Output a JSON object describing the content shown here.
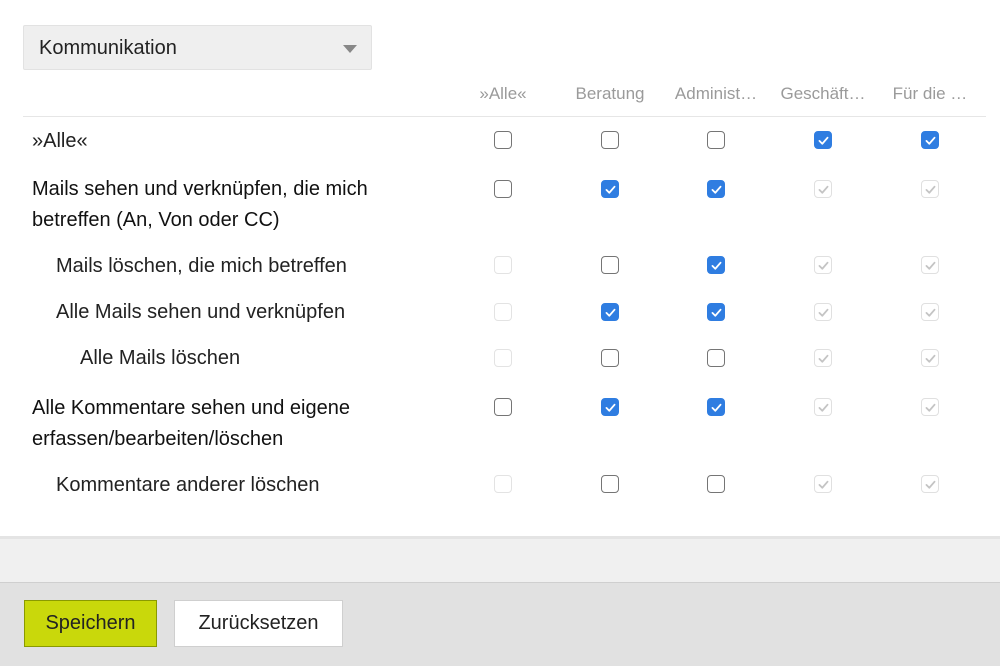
{
  "dropdown": {
    "selected": "Kommunikation",
    "caret_icon": "caret-down-icon"
  },
  "columns": [
    "»Alle«",
    "Beratung",
    "Administ…",
    "Geschäft…",
    "Für die …"
  ],
  "rows": [
    {
      "label_lines": [
        "»Alle«"
      ],
      "bold": false,
      "states": [
        "unchecked",
        "unchecked",
        "unchecked",
        "checked",
        "checked"
      ]
    },
    {
      "label_lines": [
        "Mails sehen und verknüpfen, die mich",
        "betreffen (An, Von oder CC)"
      ],
      "bold": true,
      "states": [
        "unchecked",
        "checked",
        "checked",
        "disabled-checked",
        "disabled-checked"
      ]
    },
    {
      "label_lines": [
        "Mails löschen, die mich betreffen"
      ],
      "bold": false,
      "states": [
        "disabled-empty",
        "unchecked",
        "checked",
        "disabled-checked",
        "disabled-checked"
      ]
    },
    {
      "label_lines": [
        "Alle Mails sehen und verknüpfen"
      ],
      "bold": false,
      "states": [
        "disabled-empty",
        "checked",
        "checked",
        "disabled-checked",
        "disabled-checked"
      ]
    },
    {
      "label_lines": [
        "Alle Mails löschen"
      ],
      "bold": false,
      "states": [
        "disabled-empty",
        "unchecked",
        "unchecked",
        "disabled-checked",
        "disabled-checked"
      ]
    },
    {
      "label_lines": [
        "Alle Kommentare sehen und eigene",
        "erfassen/bearbeiten/löschen"
      ],
      "bold": true,
      "states": [
        "unchecked",
        "checked",
        "checked",
        "disabled-checked",
        "disabled-checked"
      ]
    },
    {
      "label_lines": [
        "Kommentare anderer löschen"
      ],
      "bold": false,
      "states": [
        "disabled-empty",
        "unchecked",
        "unchecked",
        "disabled-checked",
        "disabled-checked"
      ]
    }
  ],
  "footer": {
    "save_label": "Speichern",
    "reset_label": "Zurücksetzen"
  },
  "colors": {
    "accent_blue": "#2f7de1",
    "save_green": "#c9d80b"
  }
}
